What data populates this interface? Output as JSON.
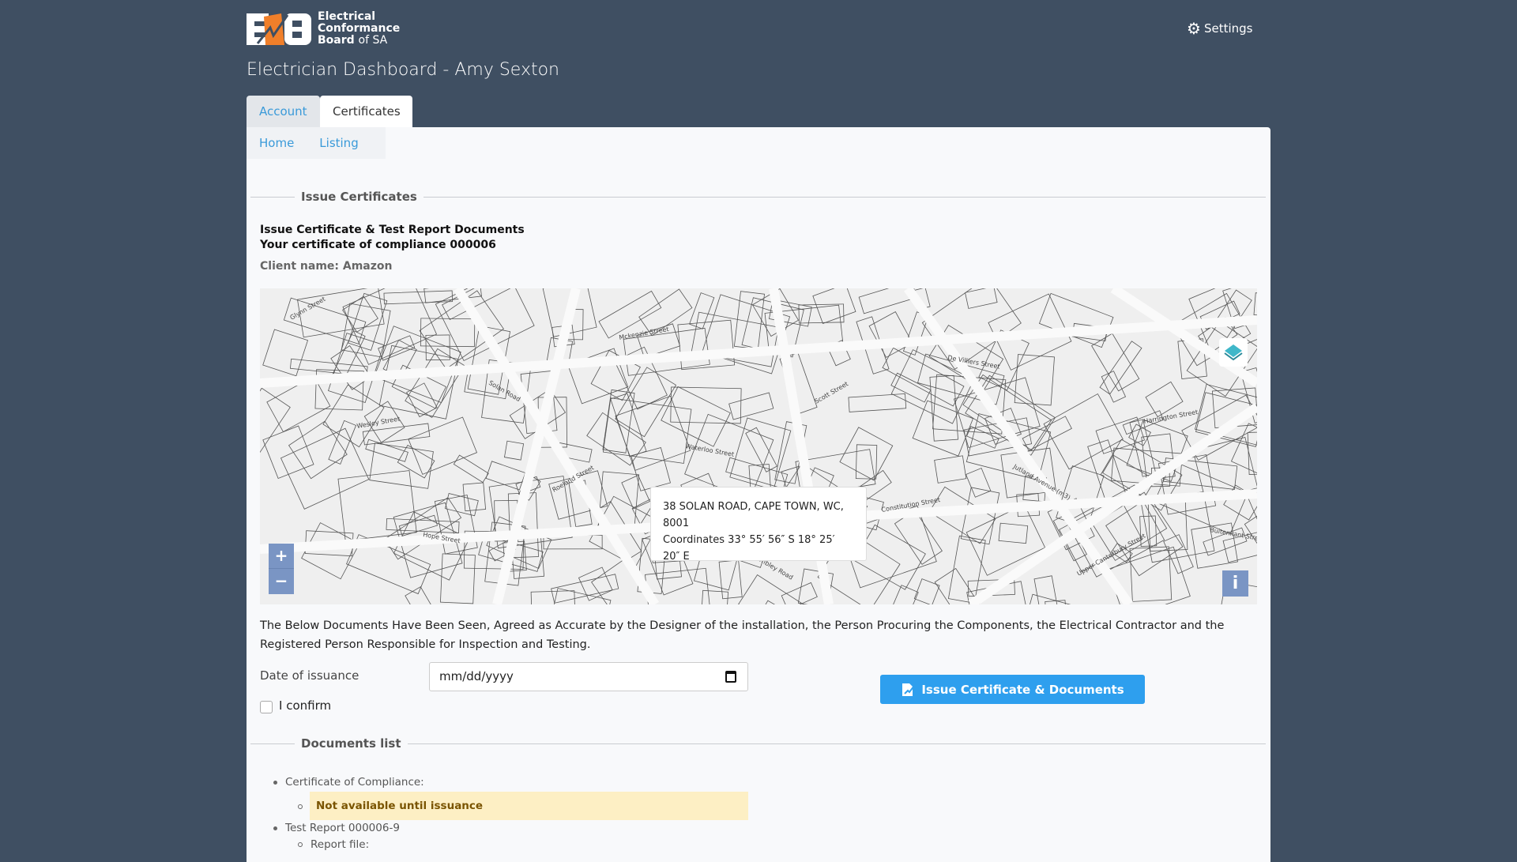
{
  "header": {
    "logo_lines": [
      "Electrical",
      "Conformance",
      "Board"
    ],
    "logo_suffix": "of SA",
    "logo_mark": "ECB",
    "settings_label": "Settings",
    "title": "Electrician Dashboard - Amy Sexton"
  },
  "tabs": [
    {
      "label": "Account",
      "active": false
    },
    {
      "label": "Certificates",
      "active": true
    }
  ],
  "subnav": [
    {
      "label": "Home"
    },
    {
      "label": "Listing"
    }
  ],
  "issue": {
    "legend": "Issue Certificates",
    "heading1": "Issue Certificate & Test Report Documents",
    "heading2": "Your certificate of compliance 000006",
    "client": "Client name: Amazon"
  },
  "map": {
    "popup_address": "38 SOLAN ROAD, CAPE TOWN, WC,",
    "popup_postcode": "8001",
    "popup_coords": "Coordinates 33° 55′ 56″ S 18° 25′ 20″ E",
    "zoom_in": "+",
    "zoom_out": "−",
    "info": "i",
    "street_labels": [
      "Glynn Street",
      "Wesley Street",
      "Hope Street",
      "Solan Road",
      "Roeland Street",
      "Mckenzie Street",
      "Waterloo Street",
      "Wembley Road",
      "Scott Street",
      "Constitution Street",
      "De Villiers Street",
      "Jutland Avenue (m3)",
      "Upper Canterbury Street",
      "Harrington Street",
      "Buitenkant Street"
    ]
  },
  "declaration": "The Below Documents Have Been Seen, Agreed as Accurate by the Designer of the installation, the Person Procuring the Components, the Electrical Contractor and the Registered Person Responsible for Inspection and Testing.",
  "form": {
    "date_label": "Date of issuance",
    "date_placeholder": "mm/dd/yyyy",
    "confirm_label": "I confirm",
    "confirm_checked": false,
    "issue_button": "Issue Certificate & Documents"
  },
  "documents": {
    "legend": "Documents list",
    "items": [
      {
        "label": "Certificate of Compliance:",
        "sub": "Not available until issuance"
      },
      {
        "label": "Test Report 000006-9",
        "sub": "Report file:"
      }
    ]
  },
  "colors": {
    "background": "#3f4f62",
    "accent": "#2e9fee",
    "link": "#3a9ad9",
    "warning_bg": "#fdefc4",
    "logo_orange": "#f07f2a"
  }
}
